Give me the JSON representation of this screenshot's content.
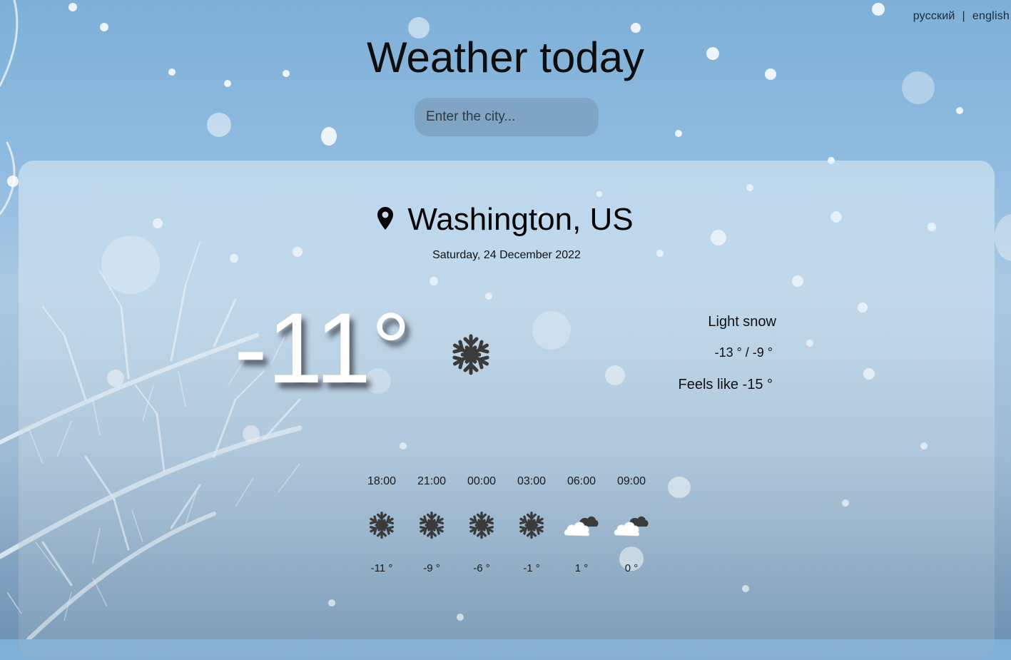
{
  "header": {
    "lang_ru": "русский",
    "lang_sep": "|",
    "lang_en": "english",
    "title": "Weather today"
  },
  "search": {
    "placeholder": "Enter the city...",
    "value": ""
  },
  "location": {
    "icon": "map-pin-icon",
    "city": "Washington, US",
    "date": "Saturday, 24 December 2022"
  },
  "current": {
    "temp": "-11°",
    "icon": "snowflake-icon",
    "description": "Light snow",
    "minmax": "-13 ° / -9 °",
    "feels_like": "Feels like  -15 °"
  },
  "forecast": [
    {
      "time": "18:00",
      "icon": "snowflake-icon",
      "temp": "-11 °"
    },
    {
      "time": "21:00",
      "icon": "snowflake-icon",
      "temp": "-9 °"
    },
    {
      "time": "00:00",
      "icon": "snowflake-icon",
      "temp": "-6 °"
    },
    {
      "time": "03:00",
      "icon": "snowflake-icon",
      "temp": "-1 °"
    },
    {
      "time": "06:00",
      "icon": "cloudy-icon",
      "temp": "1 °"
    },
    {
      "time": "09:00",
      "icon": "cloudy-icon",
      "temp": "0 °"
    }
  ],
  "colors": {
    "icon_dark": "#3a3a3a",
    "cloud_white": "#ffffff"
  }
}
